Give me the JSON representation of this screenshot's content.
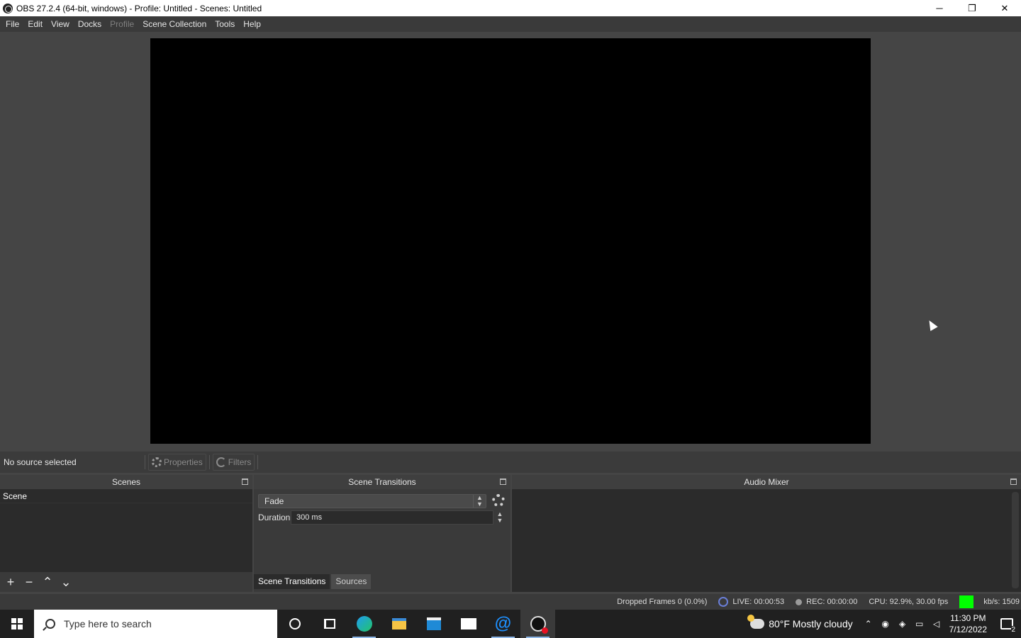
{
  "window": {
    "title": "OBS 27.2.4 (64-bit, windows) - Profile: Untitled - Scenes: Untitled",
    "minimize": "─",
    "restore": "❐",
    "close": "✕"
  },
  "menu": {
    "file": "File",
    "edit": "Edit",
    "view": "View",
    "docks": "Docks",
    "profile": "Profile",
    "scene_collection": "Scene Collection",
    "tools": "Tools",
    "help": "Help"
  },
  "source_bar": {
    "no_source": "No source selected",
    "properties": "Properties",
    "filters": "Filters"
  },
  "scenes_dock": {
    "title": "Scenes",
    "items": [
      "Scene"
    ],
    "add": "+",
    "remove": "−",
    "up": "⌃",
    "down": "⌄"
  },
  "transitions_dock": {
    "title": "Scene Transitions",
    "selected_transition": "Fade",
    "duration_label": "Duration",
    "duration_value": "300 ms"
  },
  "dock_tabs": {
    "scene_transitions": "Scene Transitions",
    "sources": "Sources"
  },
  "mixer_dock": {
    "title": "Audio Mixer"
  },
  "status": {
    "dropped_frames": "Dropped Frames 0 (0.0%)",
    "live": "LIVE: 00:00:53",
    "rec": "REC: 00:00:00",
    "cpu": "CPU: 92.9%, 30.00 fps",
    "kbps": "kb/s: 1509"
  },
  "taskbar": {
    "search_placeholder": "Type here to search",
    "weather": "80°F  Mostly cloudy",
    "time": "11:30 PM",
    "date": "7/12/2022",
    "notification_count": "2"
  }
}
